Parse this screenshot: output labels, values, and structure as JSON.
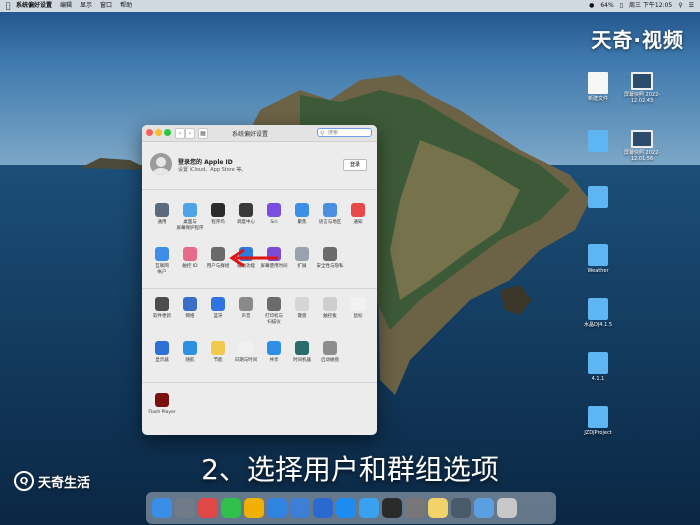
{
  "menubar": {
    "app": "系统偏好设置",
    "items": [
      "编辑",
      "显示",
      "窗口",
      "帮助"
    ],
    "battery": "64%",
    "time": "周三 下午12:05"
  },
  "watermark": {
    "top": "天奇·视频",
    "bottom": "天奇生活",
    "logo": "Q"
  },
  "subtitle": "2、选择用户和群组选项",
  "window": {
    "title": "系统偏好设置",
    "search_placeholder": "搜索",
    "account_title": "登录您的 Apple ID",
    "account_sub": "设置 iCloud、App Store 等。",
    "login_button": "登录"
  },
  "prefs": {
    "row1": [
      {
        "label": "通用",
        "icon": "general-icon",
        "color": "#5b6b7d"
      },
      {
        "label": "桌面与\n屏幕保护程序",
        "icon": "desktop-icon",
        "color": "#4fa3e8"
      },
      {
        "label": "程序坞",
        "icon": "dock-icon",
        "color": "#2b2b2b"
      },
      {
        "label": "调度中心",
        "icon": "mission-control-icon",
        "color": "#3a3a3a"
      },
      {
        "label": "Siri",
        "icon": "siri-icon",
        "color": "#7a4ee0"
      },
      {
        "label": "聚焦",
        "icon": "spotlight-icon",
        "color": "#3c8fe8"
      },
      {
        "label": "语言与地区",
        "icon": "language-icon",
        "color": "#4a90e2"
      },
      {
        "label": "通知",
        "icon": "notifications-icon",
        "color": "#e84848"
      }
    ],
    "row2": [
      {
        "label": "互联网\n帐户",
        "icon": "internet-accounts-icon",
        "color": "#3d8ee6"
      },
      {
        "label": "触控 ID",
        "icon": "touch-id-icon",
        "color": "#e86a8a"
      },
      {
        "label": "用户与群组",
        "icon": "users-icon",
        "color": "#6a6a6a"
      },
      {
        "label": "辅助功能",
        "icon": "accessibility-icon",
        "color": "#2e7be0"
      },
      {
        "label": "屏幕使用时间",
        "icon": "screen-time-icon",
        "color": "#7b4bd6"
      },
      {
        "label": "扩展",
        "icon": "extensions-icon",
        "color": "#9aa3ad"
      },
      {
        "label": "安全性与隐私",
        "icon": "security-icon",
        "color": "#6b6b6b"
      }
    ],
    "row3": [
      {
        "label": "软件更新",
        "icon": "software-update-icon",
        "color": "#4c4c4c"
      },
      {
        "label": "网络",
        "icon": "network-icon",
        "color": "#3a6fc8"
      },
      {
        "label": "蓝牙",
        "icon": "bluetooth-icon",
        "color": "#2f74e0"
      },
      {
        "label": "声音",
        "icon": "sound-icon",
        "color": "#8a8a8a"
      },
      {
        "label": "打印机与\n扫描仪",
        "icon": "printer-icon",
        "color": "#6b6b6b"
      },
      {
        "label": "键盘",
        "icon": "keyboard-icon",
        "color": "#d6d6d6"
      },
      {
        "label": "触控板",
        "icon": "trackpad-icon",
        "color": "#cfcfcf"
      },
      {
        "label": "鼠标",
        "icon": "mouse-icon",
        "color": "#f2f2f2"
      }
    ],
    "row4": [
      {
        "label": "显示器",
        "icon": "displays-icon",
        "color": "#2f6fd8"
      },
      {
        "label": "随航",
        "icon": "sidecar-icon",
        "color": "#2d8fe0"
      },
      {
        "label": "节能",
        "icon": "energy-icon",
        "color": "#f2c94c"
      },
      {
        "label": "日期与时间",
        "icon": "date-time-icon",
        "color": "#f0f0f0"
      },
      {
        "label": "共享",
        "icon": "sharing-icon",
        "color": "#2f8fe8"
      },
      {
        "label": "时间机器",
        "icon": "time-machine-icon",
        "color": "#2a6c6a"
      },
      {
        "label": "启动磁盘",
        "icon": "startup-disk-icon",
        "color": "#8c8c8c"
      }
    ],
    "row5": [
      {
        "label": "Flash Player",
        "icon": "flash-player-icon",
        "color": "#7a1010"
      }
    ]
  },
  "desktop_items": [
    {
      "cap": "新建文件",
      "kind": "doc"
    },
    {
      "cap": "屏幕快照 2022-\n12.02.43",
      "kind": "shot"
    },
    {
      "cap": "",
      "kind": "folder"
    },
    {
      "cap": "屏幕快照 2022-\n12.01.56",
      "kind": "shot"
    },
    {
      "cap": "",
      "kind": "folder"
    },
    {
      "cap": "Weather",
      "kind": "folder"
    },
    {
      "cap": "水晶DJ4.1.5",
      "kind": "folder"
    },
    {
      "cap": "4.1.1",
      "kind": "folder"
    },
    {
      "cap": "JZDJProject",
      "kind": "folder"
    }
  ],
  "dock": [
    "finder-icon",
    "rocket-icon",
    "app-icon",
    "wechat-icon",
    "chrome-icon",
    "safari-icon",
    "mail-icon",
    "xcode-icon",
    "appstore-icon",
    "upload-icon",
    "terminal-icon",
    "settings-icon",
    "notes-icon",
    "quicktime-icon",
    "preview-icon",
    "trash-icon"
  ]
}
